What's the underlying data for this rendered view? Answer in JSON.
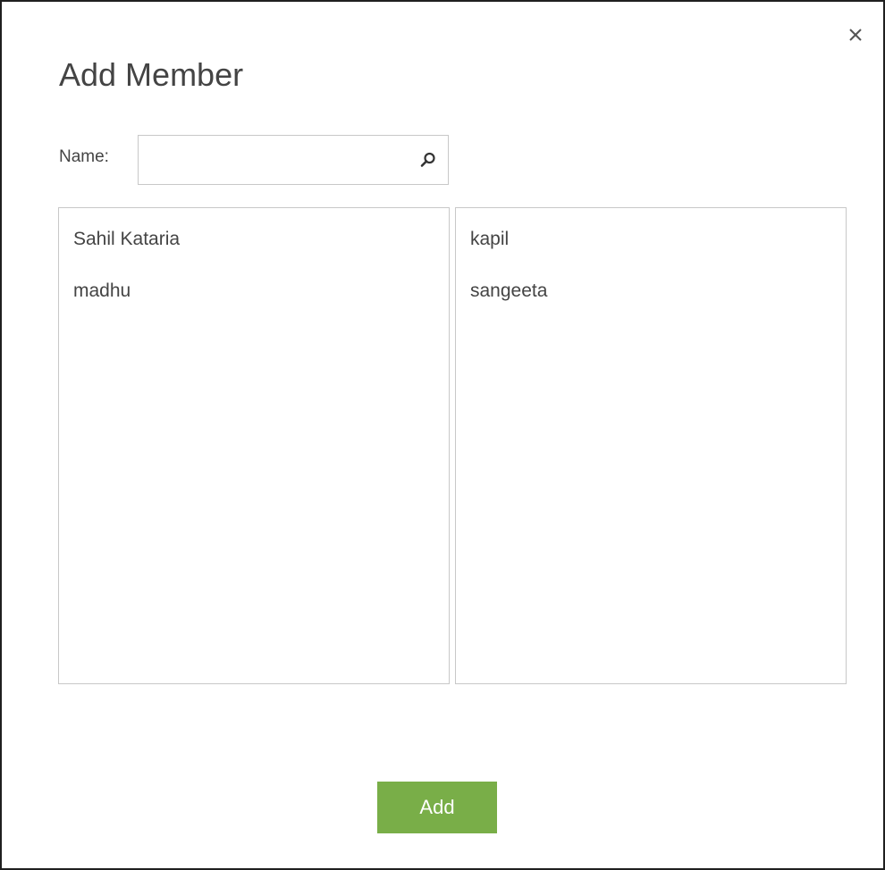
{
  "dialog": {
    "title": "Add Member",
    "close_icon": "close-icon"
  },
  "search": {
    "label": "Name:",
    "value": "",
    "placeholder": "",
    "icon": "search-icon"
  },
  "lists": {
    "left": [
      {
        "label": "Sahil Kataria"
      },
      {
        "label": "madhu"
      }
    ],
    "right": [
      {
        "label": "kapil"
      },
      {
        "label": "sangeeta"
      }
    ]
  },
  "actions": {
    "add_label": "Add"
  },
  "colors": {
    "accent": "#79ae48",
    "text": "#444444",
    "border": "#c8c8c8"
  }
}
